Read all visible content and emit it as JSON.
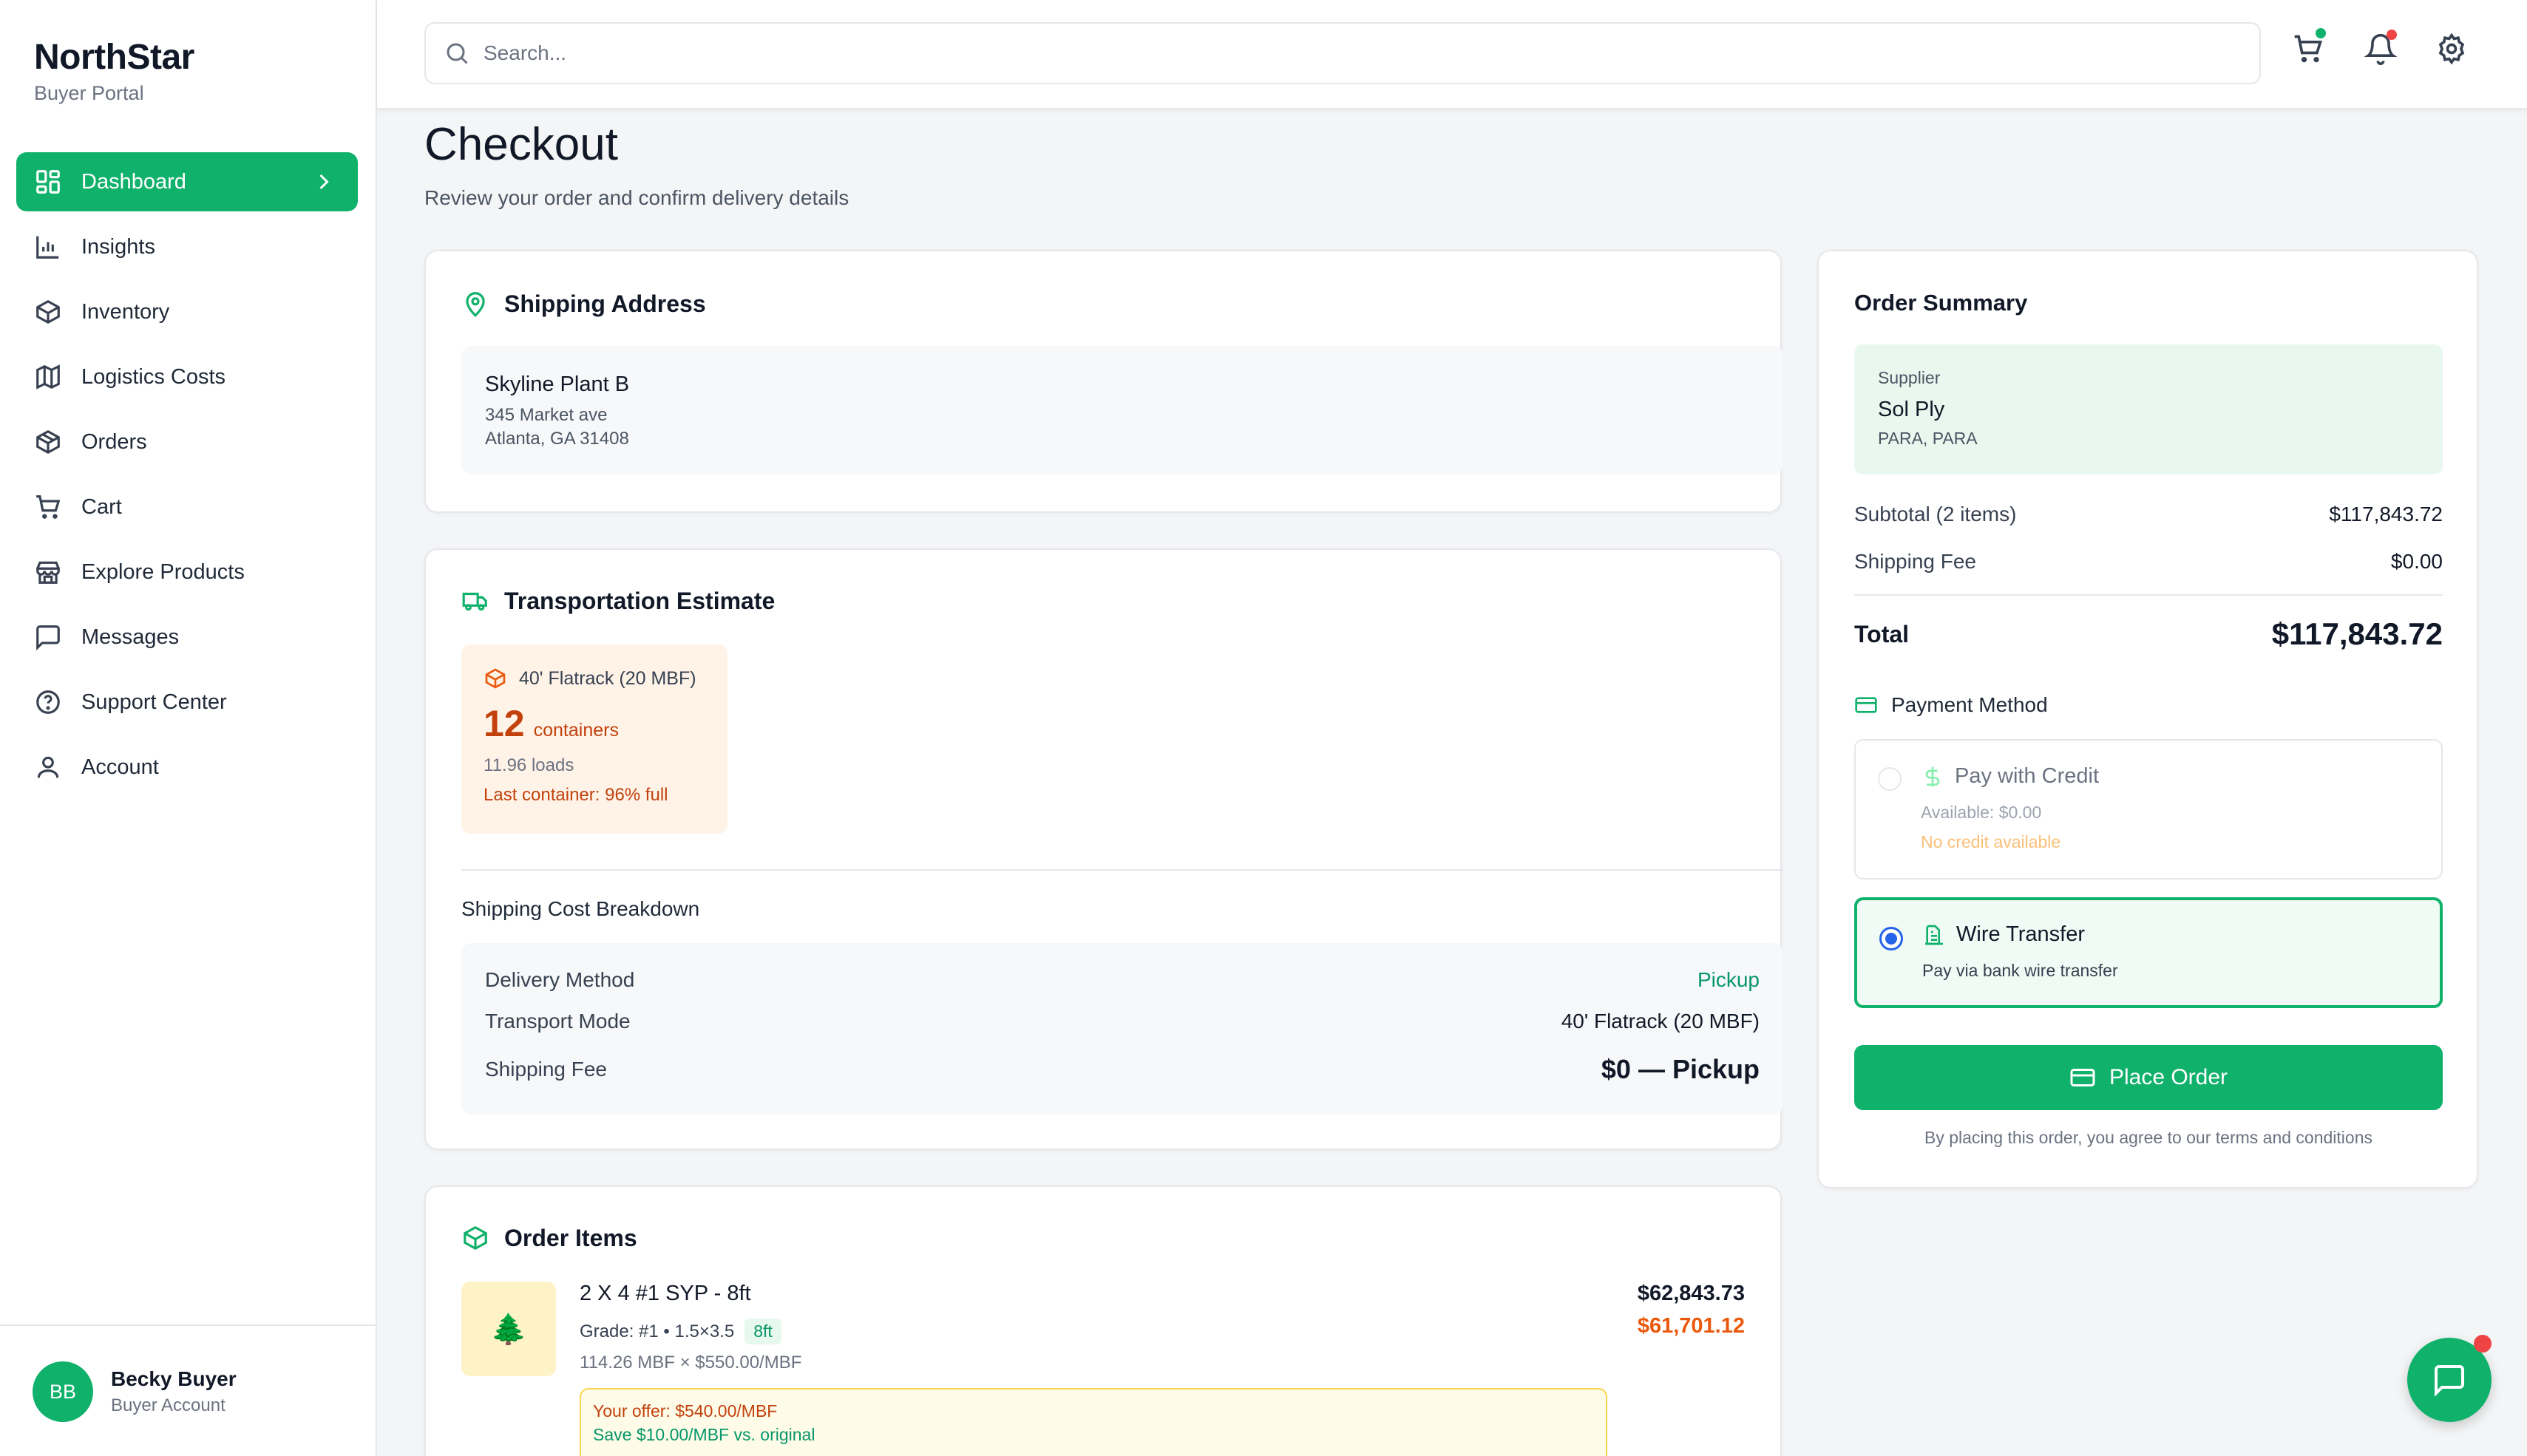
{
  "brand": {
    "title": "NorthStar",
    "subtitle": "Buyer Portal"
  },
  "sidebar": {
    "items": [
      {
        "label": "Dashboard",
        "icon": "dashboard-icon",
        "active": true
      },
      {
        "label": "Insights",
        "icon": "bar-chart-icon"
      },
      {
        "label": "Inventory",
        "icon": "box-icon"
      },
      {
        "label": "Logistics Costs",
        "icon": "map-icon"
      },
      {
        "label": "Orders",
        "icon": "package-icon"
      },
      {
        "label": "Cart",
        "icon": "cart-icon"
      },
      {
        "label": "Explore Products",
        "icon": "store-icon"
      },
      {
        "label": "Messages",
        "icon": "message-icon"
      },
      {
        "label": "Support Center",
        "icon": "help-circle-icon"
      },
      {
        "label": "Account",
        "icon": "user-icon"
      }
    ]
  },
  "user": {
    "initials": "BB",
    "name": "Becky Buyer",
    "role": "Buyer Account"
  },
  "topbar": {
    "search_placeholder": "Search..."
  },
  "page": {
    "title": "Checkout",
    "subtitle": "Review your order and confirm delivery details"
  },
  "shipping": {
    "title": "Shipping Address",
    "name": "Skyline Plant B",
    "line1": "345 Market ave",
    "line2": "Atlanta, GA 31408"
  },
  "transport": {
    "title": "Transportation Estimate",
    "container_type": "40' Flatrack (20 MBF)",
    "count": "12",
    "count_unit": "containers",
    "loads": "11.96 loads",
    "last_container": "Last container: 96% full",
    "breakdown_title": "Shipping Cost Breakdown",
    "rows": [
      {
        "label": "Delivery Method",
        "value": "Pickup"
      },
      {
        "label": "Transport Mode",
        "value": "40' Flatrack (20 MBF)"
      },
      {
        "label": "Shipping Fee",
        "value": "$0 — Pickup"
      }
    ]
  },
  "order_items": {
    "title": "Order Items",
    "items": [
      {
        "name": "2 X 4 #1 SYP - 8ft",
        "grade": "Grade: #1 • 1.5×3.5",
        "length_tag": "8ft",
        "qty": "114.26 MBF × $550.00/MBF",
        "price": "$62,843.73",
        "offer_price": "$61,701.12",
        "offer": "Your offer: $540.00/MBF",
        "savings": "Save $10.00/MBF vs. original",
        "thumb": "🌲"
      }
    ]
  },
  "summary": {
    "title": "Order Summary",
    "supplier_label": "Supplier",
    "supplier_name": "Sol Ply",
    "supplier_location": "PARA, PARA",
    "subtotal_label": "Subtotal (2 items)",
    "subtotal": "$117,843.72",
    "shipping_label": "Shipping Fee",
    "shipping": "$0.00",
    "total_label": "Total",
    "total": "$117,843.72",
    "payment_label": "Payment Method",
    "options": [
      {
        "title": "Pay with Credit",
        "sub": "Available: $0.00",
        "note": "No credit available",
        "selected": false,
        "disabled": true
      },
      {
        "title": "Wire Transfer",
        "sub": "Pay via bank wire transfer",
        "selected": true
      }
    ],
    "place_order": "Place Order",
    "terms": "By placing this order, you agree to our terms and conditions"
  },
  "colors": {
    "accent": "#10b16b",
    "warning": "#ea580c",
    "notification": "#ef4444",
    "radio_selected": "#2563eb"
  }
}
